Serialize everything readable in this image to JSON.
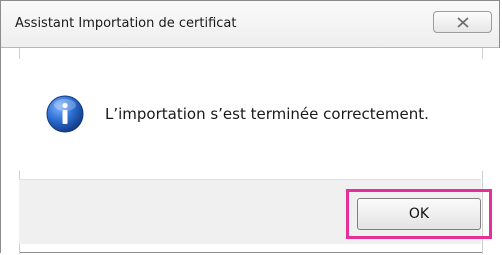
{
  "window": {
    "title": "Assistant Importation de certificat"
  },
  "dialog": {
    "message": "L’importation s’est terminée correctement.",
    "icon": "info-icon"
  },
  "buttons": {
    "ok_label": "OK",
    "close_icon": "close-icon"
  },
  "colors": {
    "highlight": "#e5309a",
    "info_blue": "#1f5fbf"
  }
}
